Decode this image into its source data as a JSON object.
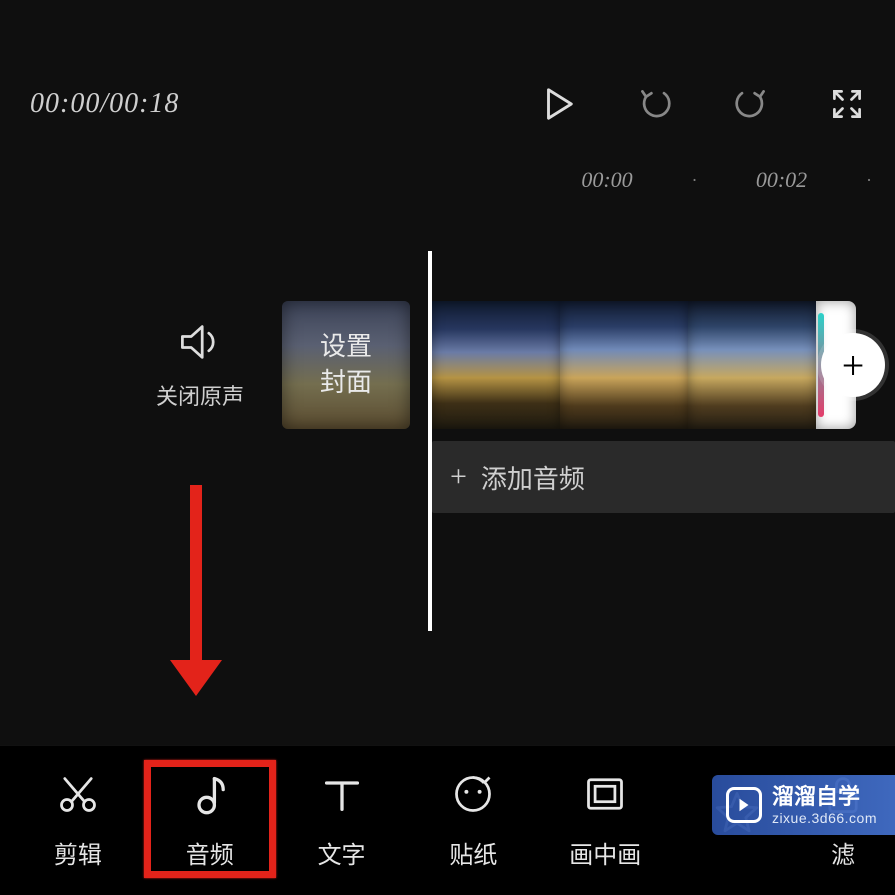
{
  "time": {
    "current": "00:00",
    "total": "00:18",
    "display": "00:00/00:18"
  },
  "ruler": {
    "ticks": [
      "00:00",
      "·",
      "00:02",
      "·"
    ]
  },
  "icons": {
    "play": "play-icon",
    "undo": "undo-icon",
    "redo": "redo-icon",
    "fullscreen": "fullscreen-icon",
    "speaker": "speaker-icon",
    "plus": "plus-icon",
    "add_small": "plus-icon"
  },
  "mute": {
    "label": "关闭原声"
  },
  "cover": {
    "line1": "设置",
    "line2": "封面"
  },
  "audio_row": {
    "label": "添加音频"
  },
  "add_clip": {
    "glyph": "+"
  },
  "tools": [
    {
      "id": "cut",
      "label": "剪辑",
      "icon": "scissors-icon"
    },
    {
      "id": "audio",
      "label": "音频",
      "icon": "music-note-icon",
      "highlighted": true
    },
    {
      "id": "text",
      "label": "文字",
      "icon": "text-icon"
    },
    {
      "id": "sticker",
      "label": "贴纸",
      "icon": "sticker-icon"
    },
    {
      "id": "pip",
      "label": "画中画",
      "icon": "picture-in-picture-icon"
    },
    {
      "id": "effects",
      "label": "",
      "icon": "star-icon",
      "partial": true
    },
    {
      "id": "filter",
      "label": "滤",
      "icon": "lock-open-icon",
      "partial": true
    }
  ],
  "annotation": {
    "highlight_tool_index": 1
  },
  "watermark": {
    "title": "溜溜自学",
    "url": "zixue.3d66.com"
  }
}
